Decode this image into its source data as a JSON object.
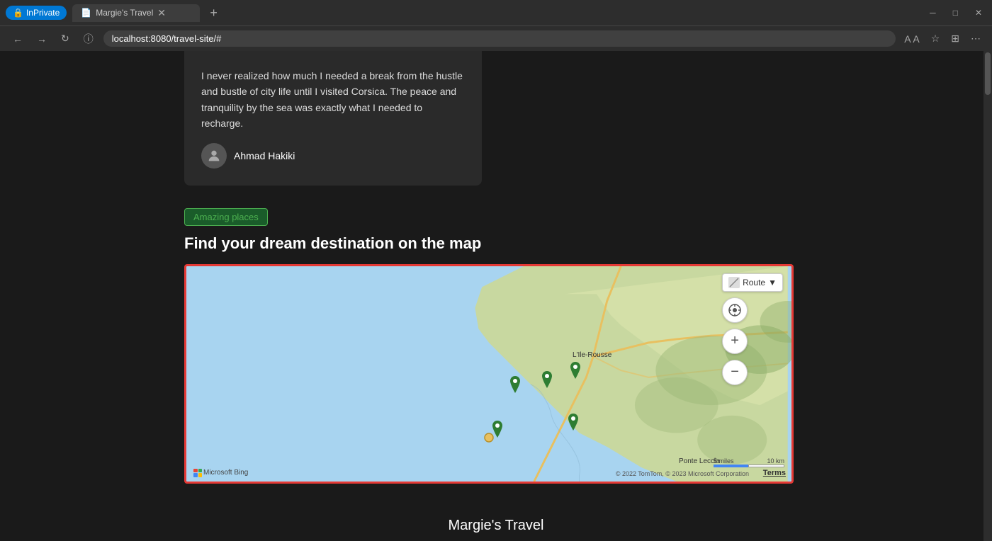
{
  "browser": {
    "inprivate": "InPrivate",
    "tab_title": "Margie's Travel",
    "url": "localhost:8080/travel-site/#",
    "new_tab_icon": "+",
    "minimize": "─",
    "maximize": "□",
    "close": "✕"
  },
  "testimonial": {
    "text": "I never realized how much I needed a break from the hustle and bustle of city life until I visited Corsica. The peace and tranquility by the sea was exactly what I needed to recharge.",
    "author": "Ahmad Hakiki"
  },
  "section": {
    "badge": "Amazing places",
    "title": "Find your dream destination on the map"
  },
  "map": {
    "route_button": "Route",
    "location_label": "L'Ile-Rousse",
    "location_label2": "Ponte Leccia",
    "attribution": "Microsoft Bing",
    "copyright": "© 2022 TomTom, © 2023 Microsoft Corporation",
    "terms": "Terms",
    "scale_miles": "5 miles",
    "scale_km": "10 km"
  },
  "footer": {
    "brand": "Margie's Travel"
  }
}
